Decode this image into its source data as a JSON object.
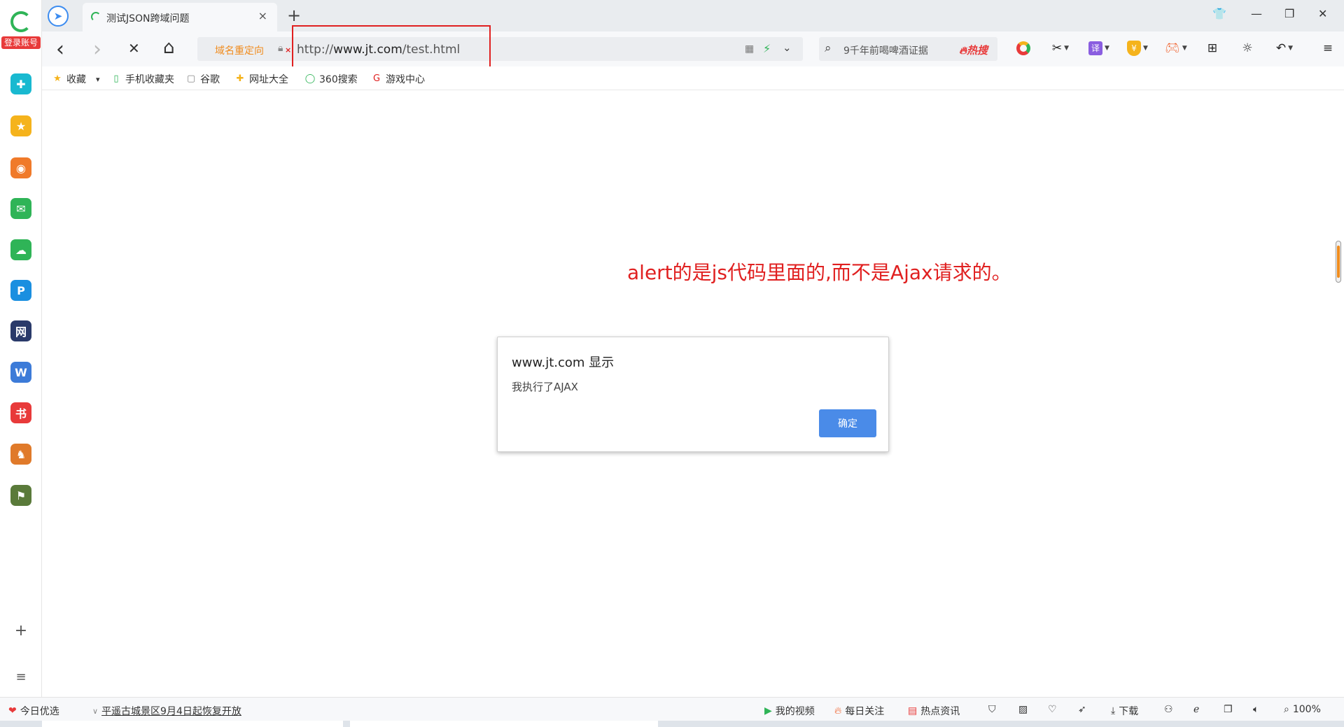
{
  "sidebar": {
    "login_label": "登录账号",
    "apps": [
      {
        "icon": "plus-circle-icon",
        "color": "#19b9d0",
        "glyph": "✚"
      },
      {
        "icon": "star-icon",
        "color": "#f5b31c",
        "glyph": "★"
      },
      {
        "icon": "weibo-icon",
        "color": "#f07a2a",
        "glyph": "◉"
      },
      {
        "icon": "mail-icon",
        "color": "#2fb457",
        "glyph": "✉"
      },
      {
        "icon": "cloud-icon",
        "color": "#2fb457",
        "glyph": "☁"
      },
      {
        "icon": "p-app-icon",
        "color": "#1a8fe0",
        "glyph": "P"
      },
      {
        "icon": "game-ask-icon",
        "color": "#2a3a6a",
        "glyph": "网"
      },
      {
        "icon": "document-icon",
        "color": "#3c7bd8",
        "glyph": "W"
      },
      {
        "icon": "xiaohongshu-icon",
        "color": "#e83a3a",
        "glyph": "书"
      },
      {
        "icon": "game-icon-1",
        "color": "#e07a2a",
        "glyph": "♞"
      },
      {
        "icon": "game-icon-2",
        "color": "#5a7a3a",
        "glyph": "⚑"
      }
    ],
    "add_glyph": "+",
    "menu_glyph": "≡"
  },
  "titlebar": {
    "tab_title": "测试JSON跨域问题",
    "tab_close": "×",
    "new_tab": "+",
    "skin_glyph": "👕",
    "minimize_glyph": "—",
    "restore_glyph": "❐",
    "close_glyph": "✕"
  },
  "toolbar": {
    "back_glyph": "‹",
    "forward_glyph": "›",
    "stop_glyph": "✕",
    "home_glyph": "⌂",
    "redirect_label": "域名重定向",
    "url_prefix": "http://",
    "url_domain": "www.jt.com",
    "url_path": "/test.html",
    "search_text": "9千年前喝啤酒证据",
    "hot_label": "热搜",
    "translate_label": "译"
  },
  "bookmarks": [
    {
      "label": "收藏",
      "icon": "star-icon",
      "color": "#f5b31c",
      "glyph": "★"
    },
    {
      "label": "手机收藏夹",
      "icon": "phone-icon",
      "color": "#2fb457",
      "glyph": "▯"
    },
    {
      "label": "谷歌",
      "icon": "page-icon",
      "color": "#888888",
      "glyph": "▢"
    },
    {
      "label": "网址大全",
      "icon": "web-icon",
      "color": "#f5b31c",
      "glyph": "✚"
    },
    {
      "label": "360搜索",
      "icon": "search360-icon",
      "color": "#2fb457",
      "glyph": "◯"
    },
    {
      "label": "游戏中心",
      "icon": "game-center-icon",
      "color": "#e02020",
      "glyph": "G"
    }
  ],
  "content": {
    "annotation": "alert的是js代码里面的,而不是Ajax请求的。",
    "dialog": {
      "title": "www.jt.com 显示",
      "message": "我执行了AJAX",
      "ok_label": "确定"
    }
  },
  "statusbar": {
    "left_item": "今日优选",
    "news_item": "平遥古城景区9月4日起恢复开放",
    "video_item": "我的视频",
    "follow_item": "每日关注",
    "hot_news_item": "热点资讯",
    "download_item": "下载",
    "zoom": "100%"
  },
  "colors": {
    "accent_red": "#e02020",
    "dialog_button": "#4a8be8",
    "brand_green": "#2fb457"
  }
}
